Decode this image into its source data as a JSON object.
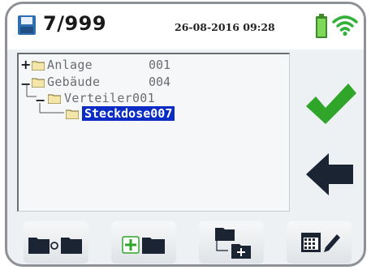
{
  "header": {
    "counter": "7/999",
    "datetime": "26-08-2016 09:28"
  },
  "tree": {
    "nodes": [
      {
        "expander": "+",
        "name": "Anlage",
        "number": "001"
      },
      {
        "expander": "−",
        "name": "Gebäude",
        "number": "004"
      },
      {
        "expander": "−",
        "name": "Verteiler001"
      },
      {
        "name": "Steckdose007",
        "selected": true
      }
    ]
  },
  "icons": {
    "save": "floppy-icon",
    "battery": "battery-icon",
    "wifi": "wifi-icon",
    "confirm": "checkmark-icon",
    "back": "arrow-left-icon",
    "toolbar": [
      "folder-move-icon",
      "folder-add-icon",
      "folder-subfolder-icon",
      "calendar-edit-icon"
    ]
  },
  "colors": {
    "accent_green": "#2fa52a",
    "selection_blue": "#0a2bc4",
    "icon_dark": "#1b2433"
  }
}
